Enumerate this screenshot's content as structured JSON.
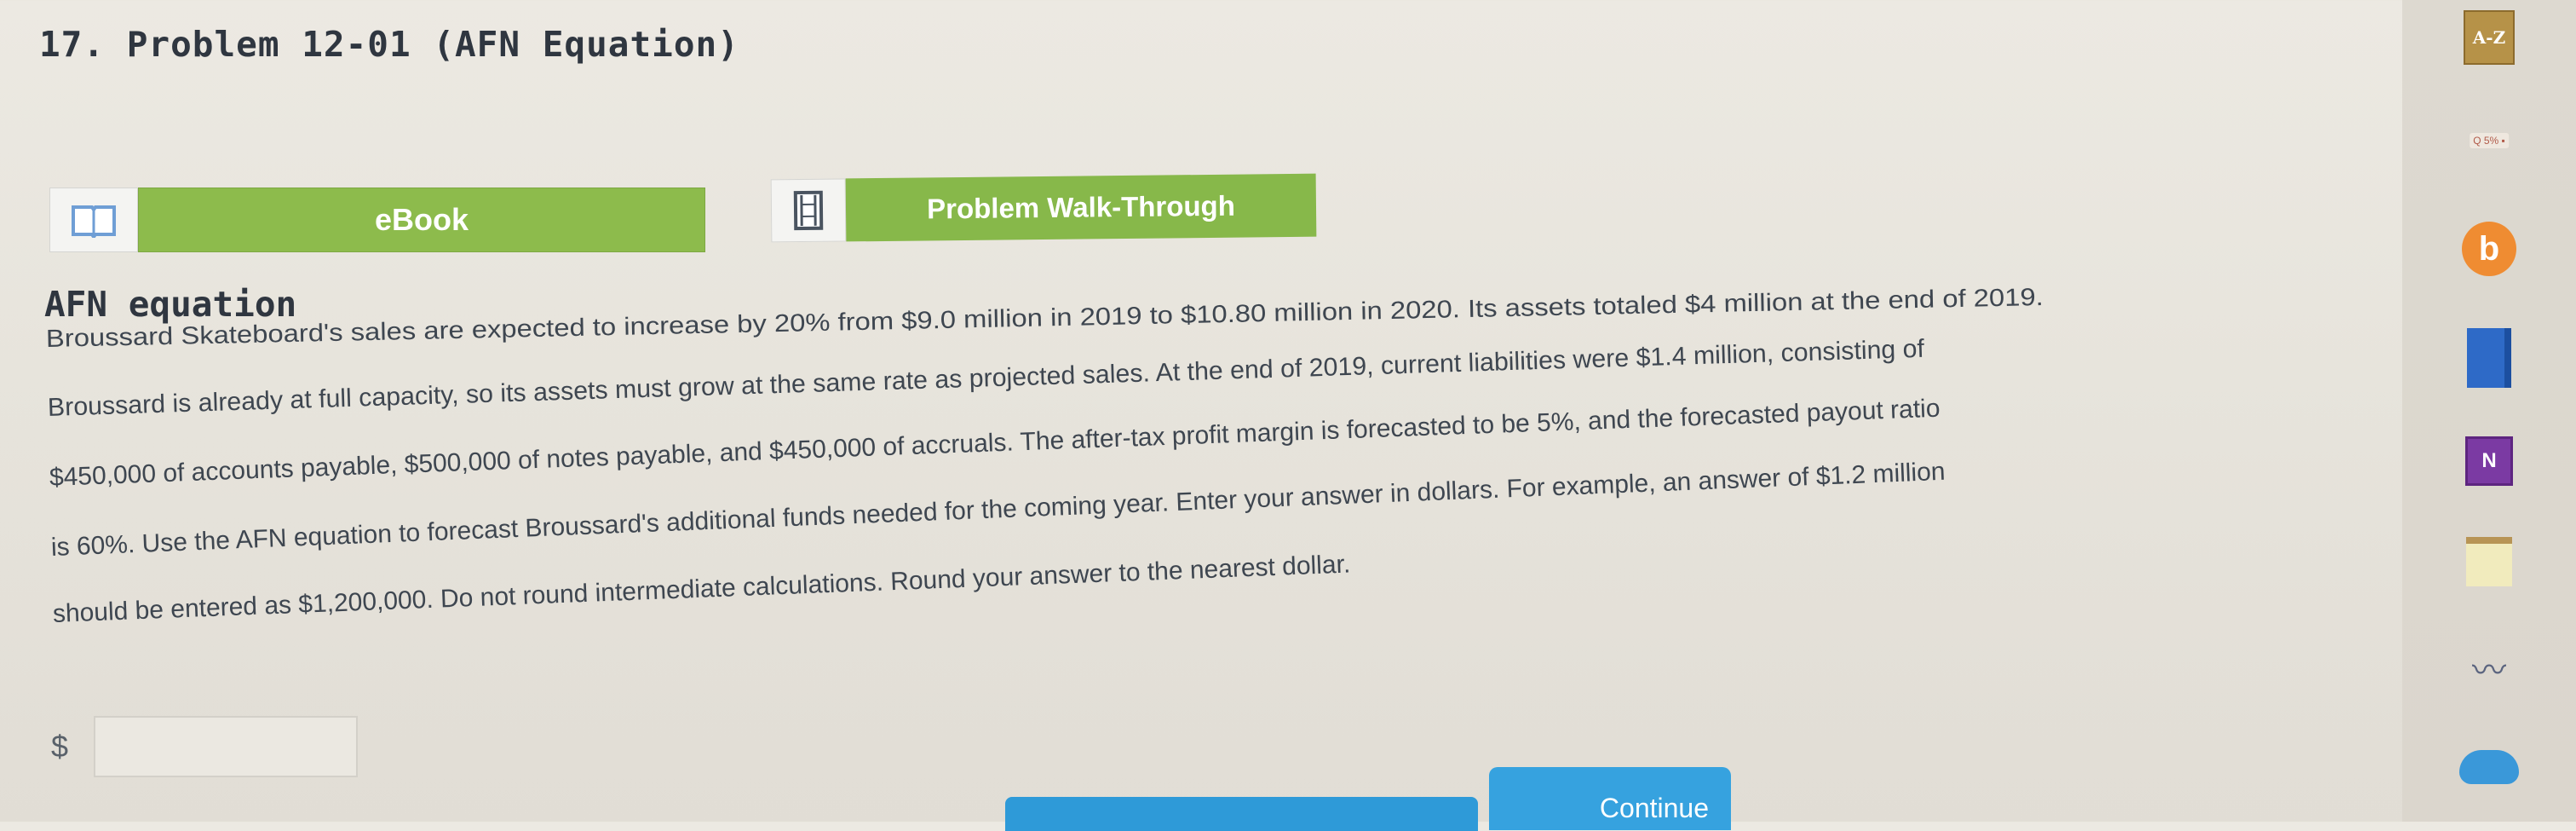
{
  "problem": {
    "title": "17. Problem 12-01 (AFN Equation)"
  },
  "tools": {
    "ebook_label": "eBook",
    "walkthrough_label": "Problem Walk-Through"
  },
  "section": {
    "heading": "AFN equation"
  },
  "paragraph": {
    "lines": [
      "Broussard Skateboard's sales are expected to increase by 20% from $9.0 million in 2019 to $10.80 million in 2020. Its assets totaled $4 million at the end of 2019.",
      "Broussard is already at full capacity, so its assets must grow at the same rate as projected sales. At the end of 2019, current liabilities were $1.4 million, consisting of",
      "$450,000 of accounts payable, $500,000 of notes payable, and $450,000 of accruals. The after-tax profit margin is forecasted to be 5%, and the forecasted payout ratio",
      "is 60%. Use the AFN equation to forecast Broussard's additional funds needed for the coming year. Enter your answer in dollars. For example, an answer of $1.2 million",
      "should be entered as $1,200,000. Do not round intermediate calculations. Round your answer to the nearest dollar."
    ]
  },
  "answer": {
    "currency": "$",
    "value": ""
  },
  "footer": {
    "continue_label": "Continue"
  },
  "taskbar": {
    "az_label": "A-Z",
    "small_label": "Q 5% ▪",
    "onenote_label": "N",
    "orange_icon_label": "b",
    "icons": [
      "dictionary-icon",
      "notification-icon",
      "orange-app-icon",
      "book-icon",
      "onenote-icon",
      "notes-icon",
      "scribble-icon",
      "cloud-icon"
    ]
  },
  "colors": {
    "accent_green": "#8dbb4c",
    "accent_blue": "#36a2df",
    "text": "#3e4650"
  }
}
